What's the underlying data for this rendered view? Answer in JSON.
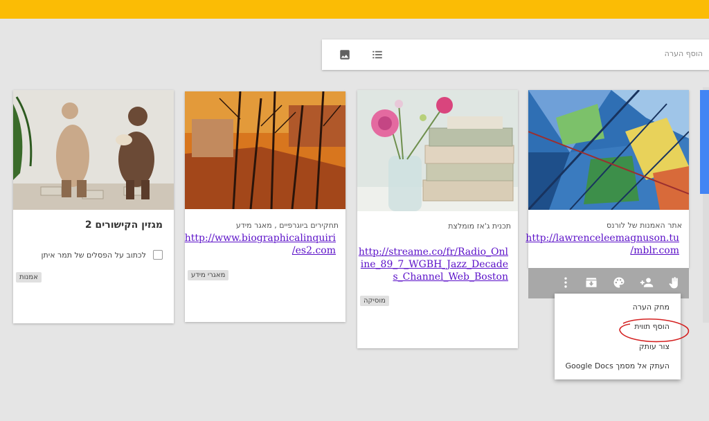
{
  "composer": {
    "placeholder": "הוסף הערה",
    "image_icon": "image-icon",
    "list_icon": "list-icon"
  },
  "cards": [
    {
      "id": "lawrence",
      "title": "אתר האמנות של לורנס",
      "link_lines": [
        "http://lawrenceleemagnuson.tu",
        "/mblr.com"
      ],
      "toolbar_icons": [
        "touch-icon",
        "add-person-icon",
        "palette-icon",
        "archive-icon",
        "more-vert-icon"
      ]
    },
    {
      "id": "jazz",
      "title": "תכנית ג'אז מומלצת",
      "link_lines": [
        "http://streame.co/fr/Radio_Onl",
        "ine_89_7_WGBH_Jazz_Decade",
        "s_Channel_Web_Boston"
      ],
      "label": "מוסיקה"
    },
    {
      "id": "bio",
      "title": "תחקירים ביוגרפיים , מאגר מידע",
      "link_lines": [
        "http://www.biographicalinquiri",
        "/es2.com"
      ],
      "label": "מאגרי מידע"
    },
    {
      "id": "mag",
      "title": "מגזין הקישורים 2",
      "checkbox_text": "לכתוב על הפסלים של תמר איתן",
      "label": "אמנות"
    }
  ],
  "menu": {
    "items": [
      "מחק הערה",
      "הוסף תווית",
      "צור עותק",
      "העתק אל מסמך Google Docs"
    ]
  },
  "colors": {
    "topbar": "#fbbc05",
    "background": "#e5e5e5",
    "link": "#5a0fc8",
    "toolbar": "#a8a8a8",
    "annotation": "#d42020"
  }
}
